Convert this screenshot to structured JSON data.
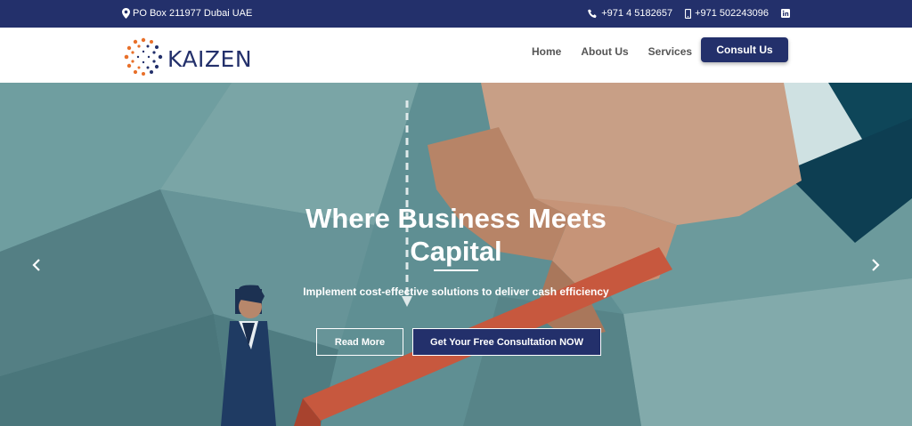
{
  "topbar": {
    "address": "PO Box 211977 Dubai UAE",
    "phone": "+971 4 5182657",
    "mobile": "+971 502243096"
  },
  "brand": {
    "name": "KAIZEN"
  },
  "nav": {
    "items": [
      {
        "label": "Home"
      },
      {
        "label": "About Us"
      },
      {
        "label": "Services"
      }
    ],
    "cta": "Consult Us"
  },
  "hero": {
    "headline": "Where Business Meets Capital",
    "subline": "Implement cost-effective solutions to deliver cash efficiency",
    "buttons": {
      "read_more": "Read More",
      "free_consult": "Get Your Free Consultation NOW"
    }
  },
  "colors": {
    "brand_navy": "#23306b",
    "accent_orange": "#e8702a",
    "hero_teal": "#5f8f93"
  },
  "icons": [
    "map-marker-icon",
    "phone-icon",
    "mobile-icon",
    "linkedin-icon",
    "chevron-left-icon",
    "chevron-right-icon"
  ]
}
